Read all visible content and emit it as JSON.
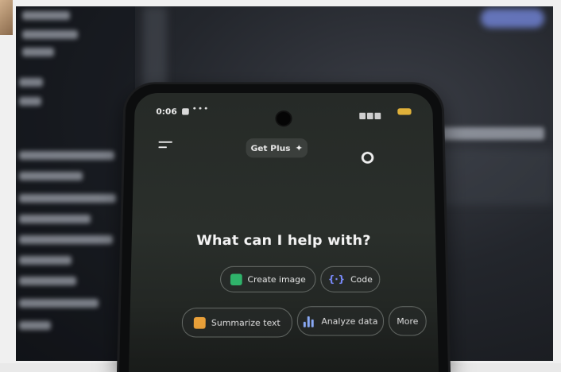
{
  "status_bar": {
    "time": "0:06",
    "dots": "•••"
  },
  "header": {
    "get_plus_label": "Get Plus",
    "sparkle_icon": "sparkle-icon",
    "menu_icon": "hamburger-menu-icon",
    "settings_icon": "settings-icon"
  },
  "main": {
    "headline": "What can I help with?",
    "chips": [
      {
        "label": "Create image",
        "icon": "create-image-icon"
      },
      {
        "label": "Code",
        "icon": "code-braces-icon"
      },
      {
        "label": "Summarize text",
        "icon": "document-icon"
      },
      {
        "label": "Analyze data",
        "icon": "bar-chart-icon"
      },
      {
        "label": "More",
        "icon": ""
      }
    ]
  },
  "colors": {
    "create_image_icon": "#2fb26a",
    "code_icon": "#7b8cff",
    "summarize_icon": "#f2a63b",
    "analyze_icon": "#8fb0ff",
    "screen_bg": "#262a27",
    "battery": "#e0b13a"
  }
}
